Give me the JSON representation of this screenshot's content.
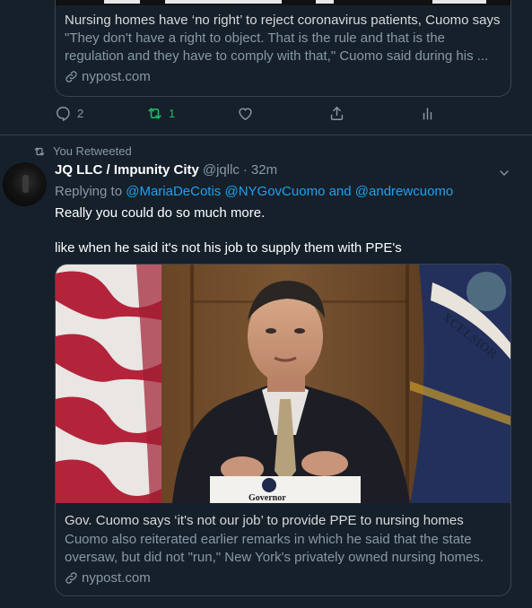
{
  "prev_card": {
    "title": "Nursing homes have ‘no right’ to reject coronavirus patients, Cuomo says",
    "description": "\"They don't have a right to object. That is the rule and that is the regulation and they have to comply with that,\" Cuomo said during his ...",
    "domain": "nypost.com"
  },
  "prev_actions": {
    "reply_count": "2",
    "retweet_count": "1",
    "retweet_color": "#17bf63"
  },
  "context": {
    "label": "You Retweeted"
  },
  "tweet": {
    "display_name": "JQ LLC / Impunity City",
    "handle": "@jqllc",
    "separator": "·",
    "time": "32m",
    "replying_prefix": "Replying to",
    "mention_1": "@MariaDeCotis",
    "mention_2": "@NYGovCuomo",
    "and_text": "and",
    "mention_3": "@andrewcuomo",
    "line_1": "Really you could do so much more.",
    "line_2": "like when he said it's not his job to supply them with PPE's"
  },
  "card": {
    "image_alt": "Gov. Cuomo speaking at a podium labeled Governor",
    "podium_label": "Governor",
    "flag_text": "XCELSIOR",
    "title": "Gov. Cuomo says ‘it's not our job’ to provide PPE to nursing homes",
    "description": "Cuomo also reiterated earlier remarks in which he said that the state oversaw, but did not \"run,\" New York's privately owned nursing homes.",
    "domain": "nypost.com"
  },
  "colors": {
    "background": "#15202b",
    "link": "#1da1f2",
    "muted": "#8899a6",
    "border": "#38444d"
  }
}
